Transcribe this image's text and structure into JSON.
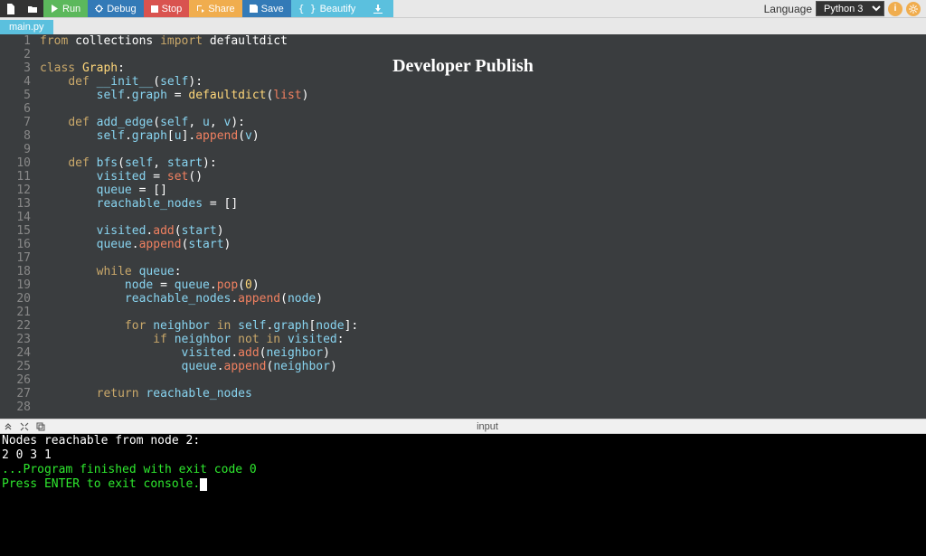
{
  "toolbar": {
    "run": "Run",
    "debug": "Debug",
    "stop": "Stop",
    "share": "Share",
    "save": "Save",
    "beautify": "Beautify",
    "language_label": "Language",
    "language_value": "Python 3"
  },
  "tab": {
    "filename": "main.py"
  },
  "watermark": "Developer Publish",
  "code": {
    "lines": [
      [
        [
          "kw",
          "from"
        ],
        [
          "wt",
          " collections "
        ],
        [
          "kw",
          "import"
        ],
        [
          "wt",
          " defaultdict"
        ]
      ],
      [],
      [
        [
          "kw",
          "class"
        ],
        [
          "wt",
          " "
        ],
        [
          "yl",
          "Graph"
        ],
        [
          "wt",
          ":"
        ]
      ],
      [
        [
          "wt",
          "    "
        ],
        [
          "kw",
          "def"
        ],
        [
          "wt",
          " "
        ],
        [
          "id",
          "__init__"
        ],
        [
          "pn",
          "("
        ],
        [
          "id",
          "self"
        ],
        [
          "pn",
          "):"
        ]
      ],
      [
        [
          "wt",
          "        "
        ],
        [
          "id",
          "self"
        ],
        [
          "wt",
          "."
        ],
        [
          "id",
          "graph"
        ],
        [
          "wt",
          " "
        ],
        [
          "op",
          "="
        ],
        [
          "wt",
          " "
        ],
        [
          "yl",
          "defaultdict"
        ],
        [
          "pn",
          "("
        ],
        [
          "fn",
          "list"
        ],
        [
          "pn",
          ")"
        ]
      ],
      [],
      [
        [
          "wt",
          "    "
        ],
        [
          "kw",
          "def"
        ],
        [
          "wt",
          " "
        ],
        [
          "id",
          "add_edge"
        ],
        [
          "pn",
          "("
        ],
        [
          "id",
          "self"
        ],
        [
          "wt",
          ", "
        ],
        [
          "id",
          "u"
        ],
        [
          "wt",
          ", "
        ],
        [
          "id",
          "v"
        ],
        [
          "pn",
          "):"
        ]
      ],
      [
        [
          "wt",
          "        "
        ],
        [
          "id",
          "self"
        ],
        [
          "wt",
          "."
        ],
        [
          "id",
          "graph"
        ],
        [
          "pn",
          "["
        ],
        [
          "id",
          "u"
        ],
        [
          "pn",
          "]."
        ],
        [
          "fn",
          "append"
        ],
        [
          "pn",
          "("
        ],
        [
          "id",
          "v"
        ],
        [
          "pn",
          ")"
        ]
      ],
      [],
      [
        [
          "wt",
          "    "
        ],
        [
          "kw",
          "def"
        ],
        [
          "wt",
          " "
        ],
        [
          "id",
          "bfs"
        ],
        [
          "pn",
          "("
        ],
        [
          "id",
          "self"
        ],
        [
          "wt",
          ", "
        ],
        [
          "id",
          "start"
        ],
        [
          "pn",
          "):"
        ]
      ],
      [
        [
          "wt",
          "        "
        ],
        [
          "id",
          "visited"
        ],
        [
          "wt",
          " "
        ],
        [
          "op",
          "="
        ],
        [
          "wt",
          " "
        ],
        [
          "fn",
          "set"
        ],
        [
          "pn",
          "()"
        ]
      ],
      [
        [
          "wt",
          "        "
        ],
        [
          "id",
          "queue"
        ],
        [
          "wt",
          " "
        ],
        [
          "op",
          "="
        ],
        [
          "wt",
          " []"
        ]
      ],
      [
        [
          "wt",
          "        "
        ],
        [
          "id",
          "reachable_nodes"
        ],
        [
          "wt",
          " "
        ],
        [
          "op",
          "="
        ],
        [
          "wt",
          " []"
        ]
      ],
      [],
      [
        [
          "wt",
          "        "
        ],
        [
          "id",
          "visited"
        ],
        [
          "wt",
          "."
        ],
        [
          "fn",
          "add"
        ],
        [
          "pn",
          "("
        ],
        [
          "id",
          "start"
        ],
        [
          "pn",
          ")"
        ]
      ],
      [
        [
          "wt",
          "        "
        ],
        [
          "id",
          "queue"
        ],
        [
          "wt",
          "."
        ],
        [
          "fn",
          "append"
        ],
        [
          "pn",
          "("
        ],
        [
          "id",
          "start"
        ],
        [
          "pn",
          ")"
        ]
      ],
      [],
      [
        [
          "wt",
          "        "
        ],
        [
          "kw",
          "while"
        ],
        [
          "wt",
          " "
        ],
        [
          "id",
          "queue"
        ],
        [
          "wt",
          ":"
        ]
      ],
      [
        [
          "wt",
          "            "
        ],
        [
          "id",
          "node"
        ],
        [
          "wt",
          " "
        ],
        [
          "op",
          "="
        ],
        [
          "wt",
          " "
        ],
        [
          "id",
          "queue"
        ],
        [
          "wt",
          "."
        ],
        [
          "fn",
          "pop"
        ],
        [
          "pn",
          "("
        ],
        [
          "yl",
          "0"
        ],
        [
          "pn",
          ")"
        ]
      ],
      [
        [
          "wt",
          "            "
        ],
        [
          "id",
          "reachable_nodes"
        ],
        [
          "wt",
          "."
        ],
        [
          "fn",
          "append"
        ],
        [
          "pn",
          "("
        ],
        [
          "id",
          "node"
        ],
        [
          "pn",
          ")"
        ]
      ],
      [],
      [
        [
          "wt",
          "            "
        ],
        [
          "kw",
          "for"
        ],
        [
          "wt",
          " "
        ],
        [
          "id",
          "neighbor"
        ],
        [
          "wt",
          " "
        ],
        [
          "kw",
          "in"
        ],
        [
          "wt",
          " "
        ],
        [
          "id",
          "self"
        ],
        [
          "wt",
          "."
        ],
        [
          "id",
          "graph"
        ],
        [
          "pn",
          "["
        ],
        [
          "id",
          "node"
        ],
        [
          "pn",
          "]:"
        ]
      ],
      [
        [
          "wt",
          "                "
        ],
        [
          "kw",
          "if"
        ],
        [
          "wt",
          " "
        ],
        [
          "id",
          "neighbor"
        ],
        [
          "wt",
          " "
        ],
        [
          "kw",
          "not"
        ],
        [
          "wt",
          " "
        ],
        [
          "kw",
          "in"
        ],
        [
          "wt",
          " "
        ],
        [
          "id",
          "visited"
        ],
        [
          "wt",
          ":"
        ]
      ],
      [
        [
          "wt",
          "                    "
        ],
        [
          "id",
          "visited"
        ],
        [
          "wt",
          "."
        ],
        [
          "fn",
          "add"
        ],
        [
          "pn",
          "("
        ],
        [
          "id",
          "neighbor"
        ],
        [
          "pn",
          ")"
        ]
      ],
      [
        [
          "wt",
          "                    "
        ],
        [
          "id",
          "queue"
        ],
        [
          "wt",
          "."
        ],
        [
          "fn",
          "append"
        ],
        [
          "pn",
          "("
        ],
        [
          "id",
          "neighbor"
        ],
        [
          "pn",
          ")"
        ]
      ],
      [],
      [
        [
          "wt",
          "        "
        ],
        [
          "kw",
          "return"
        ],
        [
          "wt",
          " "
        ],
        [
          "id",
          "reachable_nodes"
        ]
      ],
      []
    ]
  },
  "io": {
    "label": "input"
  },
  "console": {
    "lines": [
      {
        "cls": "",
        "text": "Nodes reachable from node 2:"
      },
      {
        "cls": "",
        "text": "2 0 3 1"
      },
      {
        "cls": "",
        "text": ""
      },
      {
        "cls": "",
        "text": ""
      },
      {
        "cls": "cons-grn",
        "text": "...Program finished with exit code 0"
      },
      {
        "cls": "cons-grn",
        "text": "Press ENTER to exit console.",
        "cursor": true
      }
    ]
  }
}
